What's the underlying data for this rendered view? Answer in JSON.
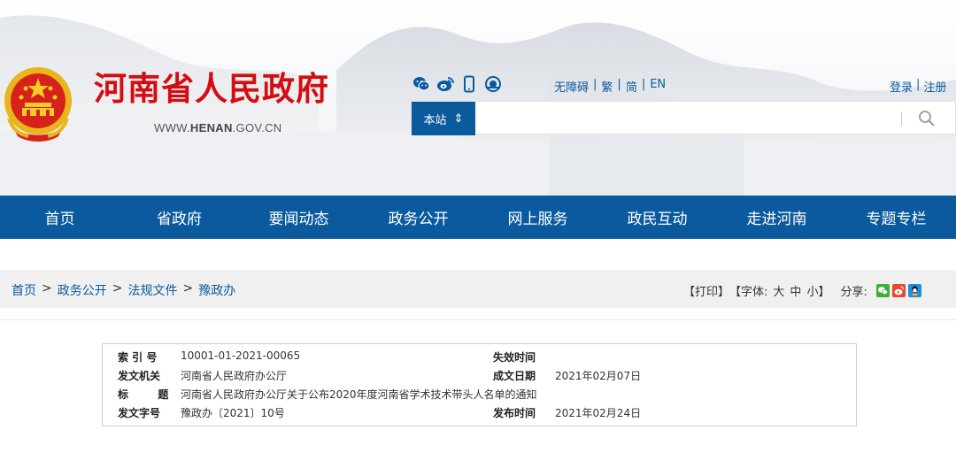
{
  "header": {
    "site_title": "河南省人民政府",
    "site_url_prefix": "WWW.",
    "site_url_bold": "HENAN",
    "site_url_suffix": ".GOV.CN",
    "links": [
      "无障碍",
      "繁",
      "简",
      "EN"
    ],
    "link_separator": "|",
    "auth": [
      "登录",
      "注册"
    ],
    "social_icons": [
      "wechat-icon",
      "weibo-icon",
      "mobile-icon",
      "app-icon"
    ],
    "accent_color": "#0b5a9e",
    "title_color": "#d40d12"
  },
  "search": {
    "scope_label": "本站",
    "scope_arrow": "⇕",
    "placeholder": "",
    "divider": "|"
  },
  "nav": {
    "items": [
      "首页",
      "省政府",
      "要闻动态",
      "政务公开",
      "网上服务",
      "政民互动",
      "走进河南",
      "专题专栏"
    ]
  },
  "breadcrumb": {
    "items": [
      "首页",
      "政务公开",
      "法规文件",
      "豫政办"
    ],
    "separator": ">"
  },
  "tools": {
    "print": "【打印】",
    "font_prefix": "【字体:",
    "font_sizes": [
      "大",
      "中",
      "小"
    ],
    "font_suffix": "】",
    "share_label": "分享:"
  },
  "meta": {
    "index_label": "索  引  号",
    "index_value": "10001-01-2021-00065",
    "expire_label": "失效时间",
    "expire_value": "",
    "issuer_label": "发文机关",
    "issuer_value": "河南省人民政府办公厅",
    "created_label": "成文日期",
    "created_value": "2021年02月07日",
    "title_label": "标        题",
    "title_value": "河南省人民政府办公厅关于公布2020年度河南省学术技术带头人名单的通知",
    "docno_label": "发文字号",
    "docno_value": "豫政办〔2021〕10号",
    "published_label": "发布时间",
    "published_value": "2021年02月24日"
  }
}
